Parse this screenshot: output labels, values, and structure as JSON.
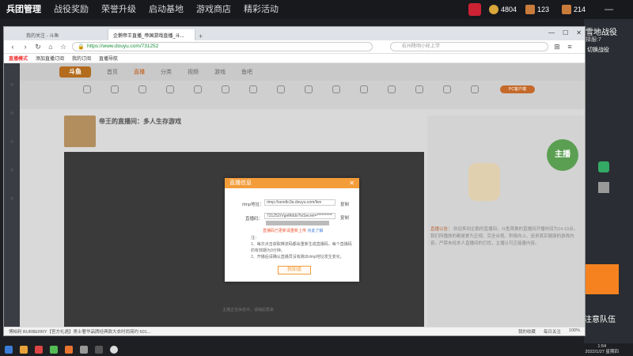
{
  "game_bar": {
    "tabs": [
      "兵团管理",
      "战役奖励",
      "荣誉升级",
      "启动基地",
      "游戏商店",
      "精彩活动"
    ],
    "currency": [
      {
        "value": "4804",
        "color": "#d9a73a"
      },
      {
        "value": "123",
        "color": "#c97b3b"
      },
      {
        "value": "214",
        "color": "#c97b3b"
      }
    ]
  },
  "right_panel": {
    "title": "雪地战役",
    "subtitle": "择服:7",
    "button": "切换战役",
    "team": "注意队伍"
  },
  "browser": {
    "tabs": [
      "我的关注 - 斗鱼",
      "企鹅帝王直播_帝国游戏直播_斗..."
    ],
    "url": "https://www.douyu.com/731252",
    "search_placeholder": "杭州降明小轮上学",
    "bookmarks": [
      "直播模式",
      "添加直播订阅",
      "我的订阅",
      "直播导航"
    ],
    "zoom": "100%"
  },
  "site": {
    "logo": "斗鱼",
    "nav": [
      "首页",
      "直播",
      "分类",
      "视频",
      "游戏",
      "鱼吧"
    ],
    "pc_button": "PC客户端",
    "stream_title": "帝王的直播间：多人生存游戏",
    "video_text": "主播正在休息中，请稍后再来",
    "announcement_tag": "直播公告：",
    "announcement": "欢迎来到企鹅的直播间，斗鱼首推的直播间开播时间为14-19点。我们所播放的都是更为正规、完全合规、积极向上、追求真实健康的游戏内容。严禁未经本人直播间的打扰，主播认可正能量内容。",
    "banner": "主播"
  },
  "modal": {
    "title": "直播信息",
    "rtmp_label": "rtmp地址：",
    "rtmp_value": "rtmp://sendtc3a.douyu.com/live",
    "code_label": "直播码：",
    "code_value": "731252rVgeMdds?txSecret=**********",
    "copy": "复制",
    "warning": "直播码已更新请重新上传",
    "refresh_link": "点此了解",
    "notes_title": "注：",
    "note1": "1、每次点击获取推流码都会重新生成直播码，每个直播码的有效期为3分钟。",
    "note2": "2、开播后请确认直播员没有跳出rtmp地址发生变化。",
    "confirm": "我知道"
  },
  "status_bar": {
    "news": "博柏利 BURBERRY【官方礼遇】男士奢华品牌经典款大衣时尚简约 601...",
    "items": [
      "我的收藏",
      "每日关注",
      "100%"
    ]
  },
  "taskbar": {
    "time": "1:54",
    "date": "2022/1/27 星期四",
    "icons": [
      "#3b7bd5",
      "#e8a23a",
      "#d44",
      "#5b5",
      "#e8752f",
      "#999",
      "#333",
      "#fff"
    ]
  }
}
